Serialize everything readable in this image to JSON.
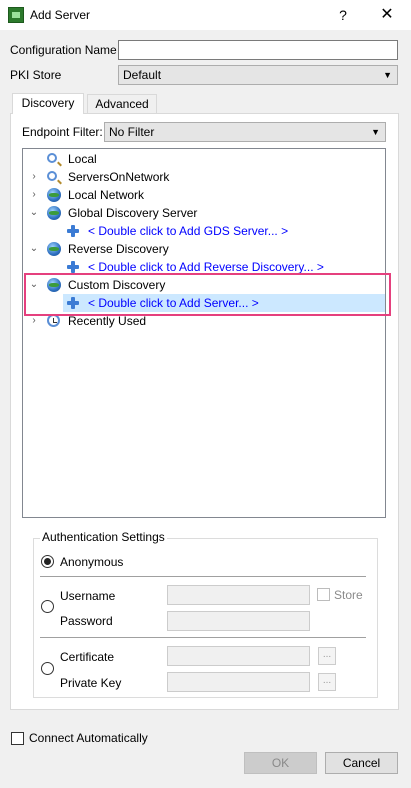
{
  "window": {
    "title": "Add Server",
    "help": "?",
    "close": "✕"
  },
  "form": {
    "config_name_label": "Configuration Name",
    "config_name_value": "",
    "pki_store_label": "PKI Store",
    "pki_store_value": "Default"
  },
  "tabs": [
    {
      "label": "Discovery",
      "active": true
    },
    {
      "label": "Advanced",
      "active": false
    }
  ],
  "discovery": {
    "endpoint_filter_label": "Endpoint Filter:",
    "endpoint_filter_value": "No Filter",
    "tree": [
      {
        "label": "Local",
        "icon": "magnifier-icon",
        "expander": ""
      },
      {
        "label": "ServersOnNetwork",
        "icon": "magnifier-icon",
        "expander": "›"
      },
      {
        "label": "Local Network",
        "icon": "globe-icon",
        "expander": "›"
      },
      {
        "label": "Global Discovery Server",
        "icon": "globe-icon",
        "expander": "⌄"
      },
      {
        "label": "< Double click to Add GDS Server... >",
        "icon": "add-icon",
        "expander": ""
      },
      {
        "label": "Reverse Discovery",
        "icon": "globe-icon",
        "expander": "⌄"
      },
      {
        "label": "< Double click to Add Reverse Discovery... >",
        "icon": "add-icon",
        "expander": ""
      },
      {
        "label": "Custom Discovery",
        "icon": "globe-icon",
        "expander": "⌄"
      },
      {
        "label": "< Double click to Add Server... >",
        "icon": "add-icon",
        "expander": ""
      },
      {
        "label": "Recently Used",
        "icon": "clock-icon",
        "expander": "›"
      }
    ]
  },
  "auth": {
    "legend": "Authentication Settings",
    "anonymous_label": "Anonymous",
    "username_label": "Username",
    "password_label": "Password",
    "store_label": "Store",
    "certificate_label": "Certificate",
    "private_key_label": "Private Key",
    "browse_label": "..."
  },
  "footer": {
    "connect_auto_label": "Connect Automatically",
    "ok_label": "OK",
    "cancel_label": "Cancel"
  },
  "colors": {
    "highlight_border": "#e5407e",
    "selection": "#cce8ff",
    "link": "#0000ff"
  }
}
